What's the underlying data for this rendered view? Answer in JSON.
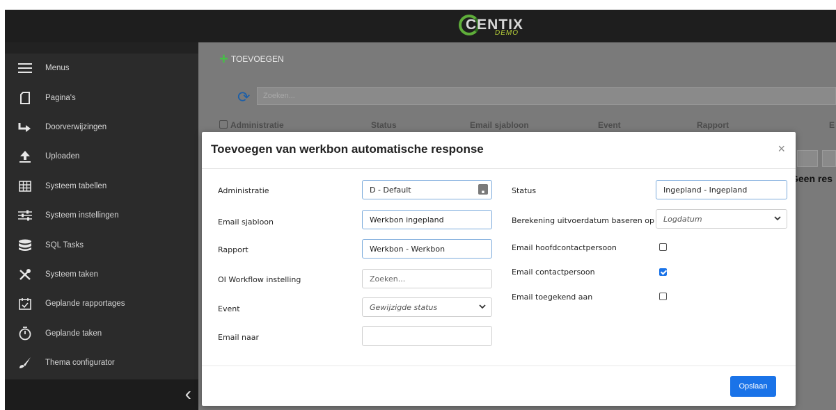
{
  "app": {
    "logo_text": "CENTIX",
    "logo_sub": "DEMO"
  },
  "sidebar": {
    "items": [
      {
        "label": "Menus",
        "icon": "menu-icon"
      },
      {
        "label": "Pagina's",
        "icon": "page-icon"
      },
      {
        "label": "Doorverwijzingen",
        "icon": "redirect-arrow-icon"
      },
      {
        "label": "Uploaden",
        "icon": "upload-icon"
      },
      {
        "label": "Systeem tabellen",
        "icon": "table-icon"
      },
      {
        "label": "Systeem instellingen",
        "icon": "sliders-icon"
      },
      {
        "label": "SQL Tasks",
        "icon": "database-icon"
      },
      {
        "label": "Systeem taken",
        "icon": "tools-icon"
      },
      {
        "label": "Geplande rapportages",
        "icon": "calendar-check-icon"
      },
      {
        "label": "Geplande taken",
        "icon": "stopwatch-icon"
      },
      {
        "label": "Thema configurator",
        "icon": "brush-icon"
      }
    ],
    "collapse_glyph": "‹"
  },
  "toolbar": {
    "add_label": "TOEVOEGEN",
    "search_placeholder": "Zoeken..."
  },
  "background_table": {
    "columns": [
      "Administratie",
      "Status",
      "Email sjabloon",
      "Event",
      "Rapport",
      "E"
    ],
    "empty_text": "Geen res"
  },
  "modal": {
    "title": "Toevoegen van werkbon automatische response",
    "close": "×",
    "left_fields": [
      {
        "label": "Administratie",
        "value": "D - Default"
      },
      {
        "label": "Email sjabloon",
        "value": "Werkbon ingepland"
      },
      {
        "label": "Rapport",
        "value": "Werkbon - Werkbon"
      },
      {
        "label": "OI Workflow instelling",
        "placeholder": "Zoeken..."
      },
      {
        "label": "Event",
        "value": "Gewijzigde status"
      },
      {
        "label": "Email naar",
        "value": ""
      }
    ],
    "right_fields": [
      {
        "label": "Status",
        "value": "Ingepland - Ingepland"
      },
      {
        "label": "Berekening uitvoerdatum baseren op",
        "value": "Logdatum"
      },
      {
        "label": "Email hoofdcontactpersoon",
        "checked": false
      },
      {
        "label": "Email contactpersoon",
        "checked": true
      },
      {
        "label": "Email toegekend aan",
        "checked": false
      }
    ],
    "save_label": "Opslaan"
  }
}
